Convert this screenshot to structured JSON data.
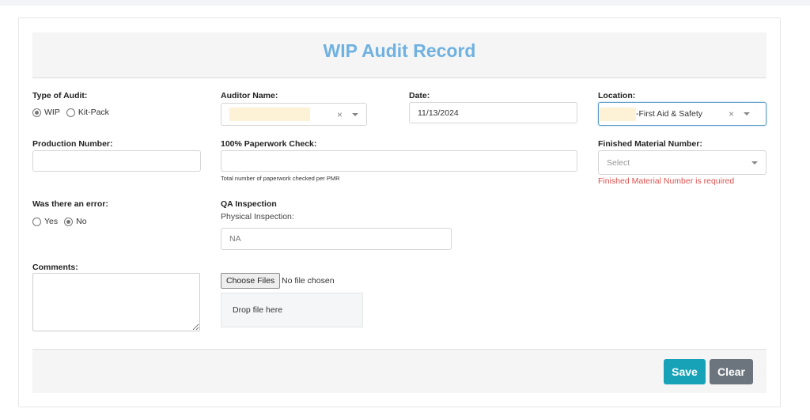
{
  "title": "WIP Audit Record",
  "type_of_audit": {
    "label": "Type of Audit:",
    "options": [
      {
        "label": "WIP",
        "checked": true
      },
      {
        "label": "Kit-Pack",
        "checked": false
      }
    ]
  },
  "auditor_name": {
    "label": "Auditor Name:",
    "value": "[redacted]"
  },
  "date": {
    "label": "Date:",
    "value": "11/13/2024"
  },
  "location": {
    "label": "Location:",
    "value_suffix": "-First Aid & Safety"
  },
  "production_number": {
    "label": "Production Number:",
    "value": ""
  },
  "paperwork_check": {
    "label": "100% Paperwork Check:",
    "value": "",
    "help": "Total number of paperwork checked per PMR"
  },
  "finished_material": {
    "label": "Finished Material Number:",
    "placeholder": "Select",
    "error": "Finished Material Number is required"
  },
  "error_question": {
    "label": "Was there an error:",
    "options": [
      {
        "label": "Yes",
        "checked": false
      },
      {
        "label": "No",
        "checked": true
      }
    ]
  },
  "qa_inspection": {
    "heading": "QA Inspection",
    "sublabel": "Physical Inspection:",
    "value": "NA"
  },
  "comments": {
    "label": "Comments:",
    "value": ""
  },
  "file_upload": {
    "button": "Choose Files",
    "status": "No file chosen",
    "dropzone": "Drop file here"
  },
  "buttons": {
    "save": "Save",
    "clear": "Clear"
  },
  "colors": {
    "title": "#6fb1e0",
    "save": "#17a2b8",
    "clear": "#6c757d",
    "error": "#d9534f"
  }
}
